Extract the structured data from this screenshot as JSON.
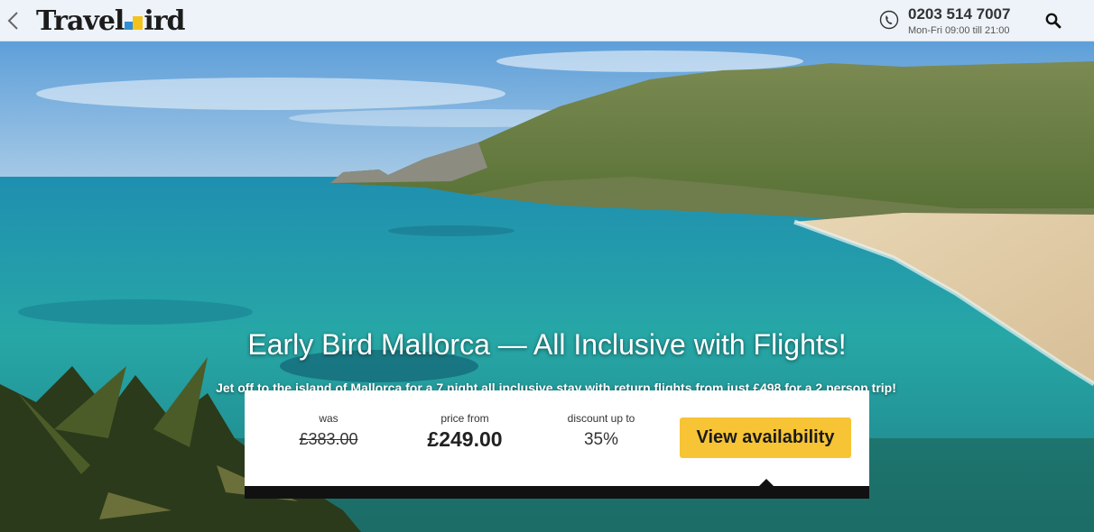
{
  "header": {
    "logo_left": "Travel",
    "logo_right": "ird",
    "phone_number": "0203 514 7007",
    "phone_hours": "Mon-Fri 09:00 till 21:00"
  },
  "hero": {
    "title": "Early Bird Mallorca — All Inclusive with Flights!",
    "subtitle": "Jet off to the island of Mallorca for a 7 night all inclusive stay with return flights from just £498 for a 2 person trip!"
  },
  "pricing": {
    "was_label": "was",
    "was_value": "£383.00",
    "price_label": "price from",
    "price_value": "£249.00",
    "discount_label": "discount up to",
    "discount_value": "35%",
    "cta_label": "View availability"
  },
  "colors": {
    "cta": "#f7c435",
    "header_bg": "#eef3f9",
    "logo_blue": "#2f8fd6",
    "logo_yellow": "#f4c21d"
  },
  "icons": {
    "back": "chevron-left-icon",
    "phone": "phone-icon",
    "search": "search-icon"
  }
}
